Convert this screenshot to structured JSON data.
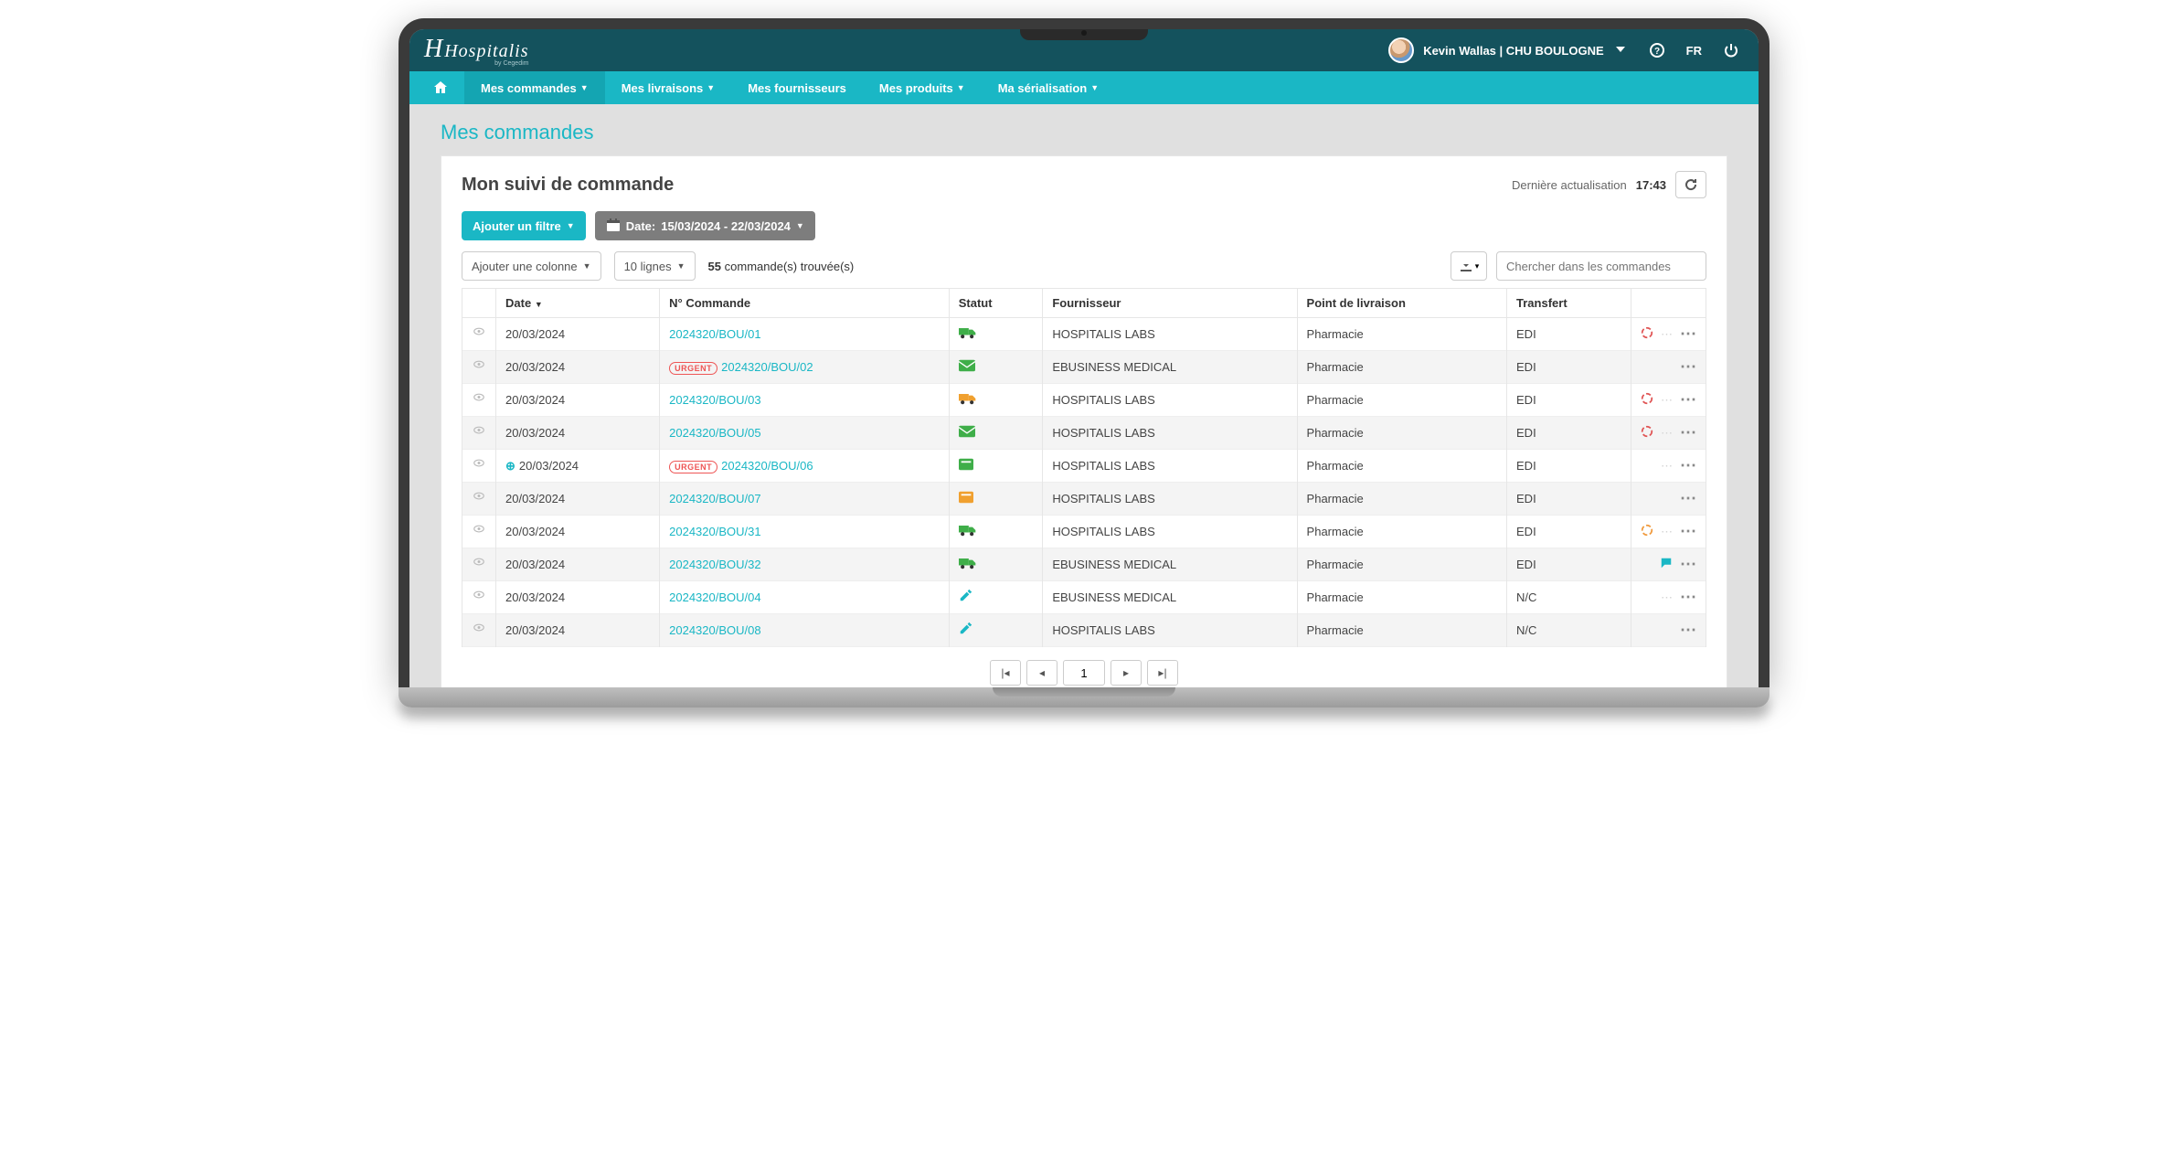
{
  "brand": {
    "name": "Hospitalis",
    "sub": "by Cegedim"
  },
  "user": {
    "display": "Kevin Wallas | CHU BOULOGNE"
  },
  "locale": "FR",
  "nav": {
    "items": [
      {
        "label": "Mes commandes",
        "active": true,
        "dd": true
      },
      {
        "label": "Mes livraisons",
        "dd": true
      },
      {
        "label": "Mes fournisseurs",
        "dd": false
      },
      {
        "label": "Mes produits",
        "dd": true
      },
      {
        "label": "Ma sérialisation",
        "dd": true
      }
    ]
  },
  "page": {
    "breadcrumb": "Mes commandes",
    "title": "Mon suivi de commande",
    "last_update_label": "Dernière actualisation",
    "last_update_time": "17:43"
  },
  "filters": {
    "add_filter": "Ajouter un filtre",
    "date_label": "Date:",
    "date_range": "15/03/2024 - 22/03/2024"
  },
  "toolbar": {
    "add_column": "Ajouter une colonne",
    "rows_label": "10 lignes",
    "found_count": "55",
    "found_suffix": "commande(s) trouvée(s)",
    "search_placeholder": "Chercher dans les commandes"
  },
  "columns": {
    "date": "Date",
    "order_no": "N° Commande",
    "status": "Statut",
    "supplier": "Fournisseur",
    "delivery_point": "Point de livraison",
    "transfer": "Transfert"
  },
  "rows": [
    {
      "date": "20/03/2024",
      "order": "2024320/BOU/01",
      "urgent": false,
      "status": "truck-green",
      "supplier": "HOSPITALIS LABS",
      "delivery": "Pharmacie",
      "transfer": "EDI",
      "ind": "missing-red",
      "expand": false
    },
    {
      "date": "20/03/2024",
      "order": "2024320/BOU/02",
      "urgent": true,
      "status": "mail-green",
      "supplier": "EBUSINESS MEDICAL",
      "delivery": "Pharmacie",
      "transfer": "EDI",
      "ind": "none",
      "expand": false
    },
    {
      "date": "20/03/2024",
      "order": "2024320/BOU/03",
      "urgent": false,
      "status": "truck-orange",
      "supplier": "HOSPITALIS LABS",
      "delivery": "Pharmacie",
      "transfer": "EDI",
      "ind": "missing-red",
      "expand": false
    },
    {
      "date": "20/03/2024",
      "order": "2024320/BOU/05",
      "urgent": false,
      "status": "mail-green",
      "supplier": "HOSPITALIS LABS",
      "delivery": "Pharmacie",
      "transfer": "EDI",
      "ind": "missing-red",
      "expand": false
    },
    {
      "date": "20/03/2024",
      "order": "2024320/BOU/06",
      "urgent": true,
      "status": "box-green",
      "supplier": "HOSPITALIS LABS",
      "delivery": "Pharmacie",
      "transfer": "EDI",
      "ind": "gray",
      "expand": true
    },
    {
      "date": "20/03/2024",
      "order": "2024320/BOU/07",
      "urgent": false,
      "status": "box-orange",
      "supplier": "HOSPITALIS LABS",
      "delivery": "Pharmacie",
      "transfer": "EDI",
      "ind": "none",
      "expand": false
    },
    {
      "date": "20/03/2024",
      "order": "2024320/BOU/31",
      "urgent": false,
      "status": "truck-green",
      "supplier": "HOSPITALIS LABS",
      "delivery": "Pharmacie",
      "transfer": "EDI",
      "ind": "missing-orange",
      "expand": false
    },
    {
      "date": "20/03/2024",
      "order": "2024320/BOU/32",
      "urgent": false,
      "status": "truck-green",
      "supplier": "EBUSINESS MEDICAL",
      "delivery": "Pharmacie",
      "transfer": "EDI",
      "ind": "comment-blue",
      "expand": false
    },
    {
      "date": "20/03/2024",
      "order": "2024320/BOU/04",
      "urgent": false,
      "status": "pencil-blue",
      "supplier": "EBUSINESS MEDICAL",
      "delivery": "Pharmacie",
      "transfer": "N/C",
      "ind": "gray",
      "expand": false
    },
    {
      "date": "20/03/2024",
      "order": "2024320/BOU/08",
      "urgent": false,
      "status": "pencil-blue",
      "supplier": "HOSPITALIS LABS",
      "delivery": "Pharmacie",
      "transfer": "N/C",
      "ind": "none",
      "expand": false
    }
  ],
  "urgent_label": "URGENT",
  "pager": {
    "current": "1"
  }
}
